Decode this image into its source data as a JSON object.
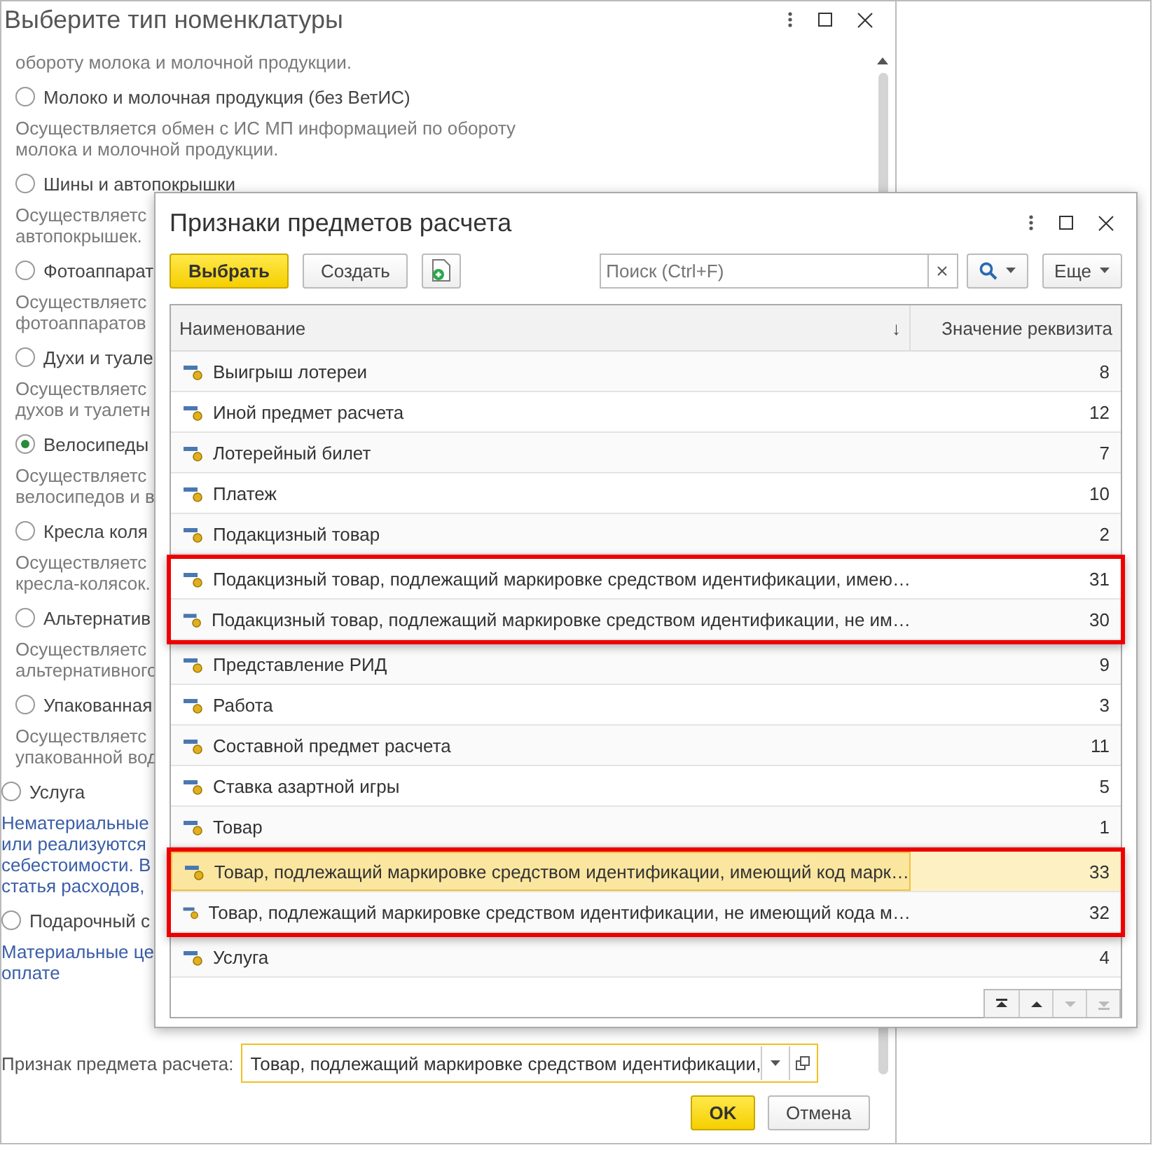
{
  "background_window": {
    "title": "Выберите тип номенклатуры",
    "top_text": "обороту молока и молочной продукции.",
    "marked_options": [
      {
        "label": "Молоко и молочная продукция (без ВетИС)",
        "selected": false,
        "description": [
          "Осуществляется обмен с ИС МП информацией по обороту",
          "молока и молочной продукции."
        ]
      },
      {
        "label": "Шины и автопокрышки",
        "selected": false,
        "description": [
          "Осуществляетс",
          "автопокрышек."
        ]
      },
      {
        "label": "Фотоаппарат",
        "selected": false,
        "description": [
          "Осуществляетс",
          "фотоаппаратов"
        ]
      },
      {
        "label": "Духи и туале",
        "selected": false,
        "description": [
          "Осуществляетс",
          "духов и туалетн"
        ]
      },
      {
        "label": "Велосипеды",
        "selected": true,
        "description": [
          "Осуществляетс",
          "велосипедов и в"
        ]
      },
      {
        "label": "Кресла коля",
        "selected": false,
        "description": [
          "Осуществляетс",
          "кресла-колясок."
        ]
      },
      {
        "label": "Альтернатив",
        "selected": false,
        "description": [
          "Осуществляетс",
          "альтернативного"
        ]
      },
      {
        "label": "Упакованная",
        "selected": false,
        "description": [
          "Осуществляетс",
          "упакованной вод"
        ]
      }
    ],
    "other_options": [
      {
        "label": "Услуга",
        "selected": false,
        "description": [
          "Нематериальные",
          "или реализуются",
          "себестоимости. В",
          "статья расходов,"
        ]
      },
      {
        "label": "Подарочный с",
        "selected": false,
        "description": [
          "Материальные це",
          "оплате"
        ]
      }
    ],
    "field": {
      "label": "Признак предмета расчета:",
      "value": "Товар, подлежащий маркировке средством идентификации,"
    },
    "buttons": [
      {
        "label": "OK",
        "kind": "primary"
      },
      {
        "label": "Отмена",
        "kind": "normal"
      }
    ]
  },
  "dialog": {
    "title": "Признаки предметов расчета",
    "toolbar": {
      "select": "Выбрать",
      "create": "Создать",
      "search_placeholder": "Поиск (Ctrl+F)",
      "more": "Еще"
    },
    "table": {
      "columns": [
        {
          "label": "Наименование",
          "sort_arrow": "↓"
        },
        {
          "label": "Значение реквизита"
        }
      ],
      "rows": [
        {
          "name": "Выигрыш лотереи",
          "value": "8",
          "selected": false,
          "outlined": false
        },
        {
          "name": "Иной предмет расчета",
          "value": "12",
          "selected": false,
          "outlined": false
        },
        {
          "name": "Лотерейный билет",
          "value": "7",
          "selected": false,
          "outlined": false
        },
        {
          "name": "Платеж",
          "value": "10",
          "selected": false,
          "outlined": false
        },
        {
          "name": "Подакцизный товар",
          "value": "2",
          "selected": false,
          "outlined": false
        },
        {
          "name": "Подакцизный товар, подлежащий маркировке средством идентификации, имею…",
          "value": "31",
          "selected": false,
          "outlined": true
        },
        {
          "name": "Подакцизный товар, подлежащий маркировке средством идентификации, не им…",
          "value": "30",
          "selected": false,
          "outlined": true
        },
        {
          "name": "Представление РИД",
          "value": "9",
          "selected": false,
          "outlined": false
        },
        {
          "name": "Работа",
          "value": "3",
          "selected": false,
          "outlined": false
        },
        {
          "name": "Составной предмет расчета",
          "value": "11",
          "selected": false,
          "outlined": false
        },
        {
          "name": "Ставка азартной игры",
          "value": "5",
          "selected": false,
          "outlined": false
        },
        {
          "name": "Товар",
          "value": "1",
          "selected": false,
          "outlined": false
        },
        {
          "name": "Товар, подлежащий маркировке средством идентификации, имеющий код марк…",
          "value": "33",
          "selected": true,
          "outlined": true
        },
        {
          "name": "Товар, подлежащий маркировке средством идентификации, не имеющий кода м…",
          "value": "32",
          "selected": false,
          "outlined": true
        },
        {
          "name": "Услуга",
          "value": "4",
          "selected": false,
          "outlined": false
        }
      ]
    },
    "navigation": [
      {
        "kind": "first",
        "disabled": false
      },
      {
        "kind": "up",
        "disabled": false
      },
      {
        "kind": "down",
        "disabled": true
      },
      {
        "kind": "last",
        "disabled": true
      }
    ]
  }
}
